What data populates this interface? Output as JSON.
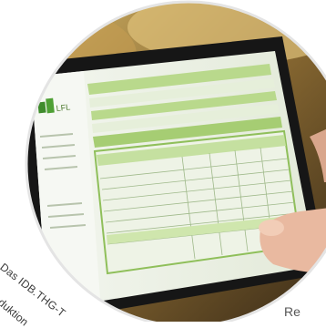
{
  "photo": {
    "subject": "tablet-displaying-web-form",
    "tablet_logo_text": "LFL",
    "colors": {
      "screen_green": "#b9d98c",
      "panel_bg": "#eef3e6",
      "tablet_frame": "#1a1a1a",
      "background_blur": "#b58a3a"
    }
  },
  "captions": {
    "line_1": "Das IDB.THG-T",
    "line_2": "roduktion",
    "line_3": "Re"
  }
}
